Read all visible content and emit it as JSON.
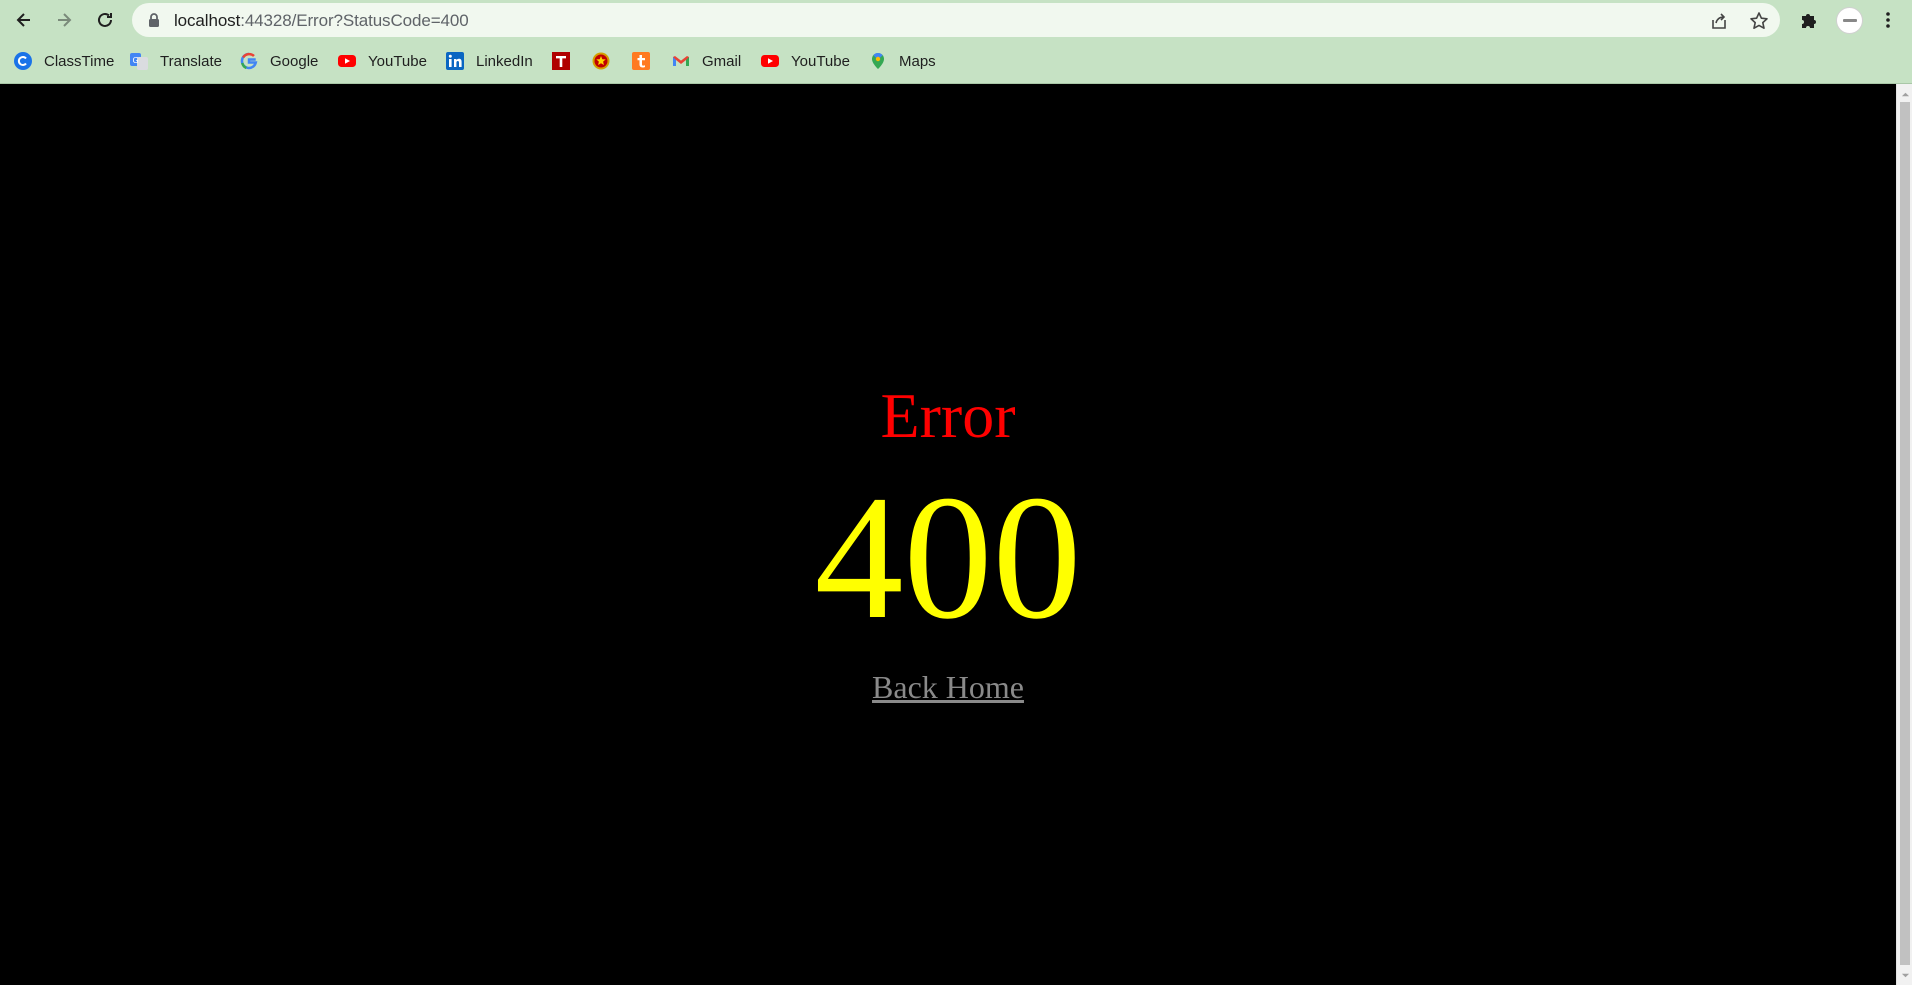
{
  "browser": {
    "url_host": "localhost",
    "url_rest": ":44328/Error?StatusCode=400",
    "icons": {
      "back": "back-arrow-icon",
      "forward": "forward-arrow-icon",
      "reload": "reload-icon",
      "lock": "lock-icon",
      "share": "share-icon",
      "star": "bookmark-star-icon",
      "extensions": "puzzle-icon",
      "menu": "kebab-menu-icon"
    },
    "colors": {
      "chrome_bg": "#c6e2c4",
      "omnibox_bg": "#f1f8ef"
    }
  },
  "bookmarks": [
    {
      "label": "ClassTime",
      "icon": "classtime-icon"
    },
    {
      "label": "Translate",
      "icon": "translate-icon"
    },
    {
      "label": "Google",
      "icon": "google-icon"
    },
    {
      "label": "YouTube",
      "icon": "youtube-icon"
    },
    {
      "label": "LinkedIn",
      "icon": "linkedin-icon"
    },
    {
      "label": "",
      "icon": "t-red-icon"
    },
    {
      "label": "",
      "icon": "emblem-icon"
    },
    {
      "label": "",
      "icon": "t-orange-icon"
    },
    {
      "label": "Gmail",
      "icon": "gmail-icon"
    },
    {
      "label": "YouTube",
      "icon": "youtube-icon"
    },
    {
      "label": "Maps",
      "icon": "maps-icon"
    }
  ],
  "page": {
    "title": "Error",
    "code": "400",
    "back_link": "Back Home",
    "colors": {
      "background": "#000000",
      "title": "#ff0000",
      "code": "#ffff00",
      "link": "#8a8a8a"
    }
  }
}
